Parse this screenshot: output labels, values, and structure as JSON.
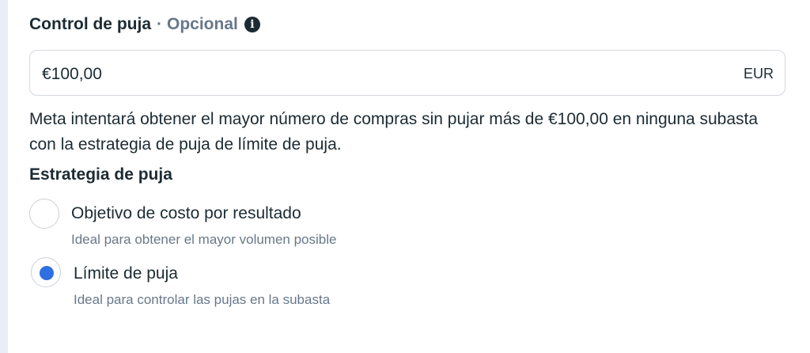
{
  "bid_control": {
    "title": "Control de puja",
    "separator": "·",
    "optional": "Opcional",
    "info_icon": "info-icon",
    "value": "€100,00",
    "currency": "EUR",
    "helper": "Meta intentará obtener el mayor número de compras sin pujar más de €100,00 en ninguna subasta con la estrategia de puja de límite de puja."
  },
  "bid_strategy": {
    "title": "Estrategia de puja",
    "selected": "bid_cap",
    "options": [
      {
        "id": "cost_per_result_goal",
        "label": "Objetivo de costo por resultado",
        "description": "Ideal para obtener el mayor volumen posible",
        "checked": false
      },
      {
        "id": "bid_cap",
        "label": "Límite de puja",
        "description": "Ideal para controlar las pujas en la subasta",
        "checked": true
      }
    ]
  },
  "colors": {
    "accent": "#2f6fe4",
    "text": "#1c2b33",
    "secondary_text": "#67788a",
    "border": "#d4d9df",
    "page_background": "#e9edf7"
  }
}
